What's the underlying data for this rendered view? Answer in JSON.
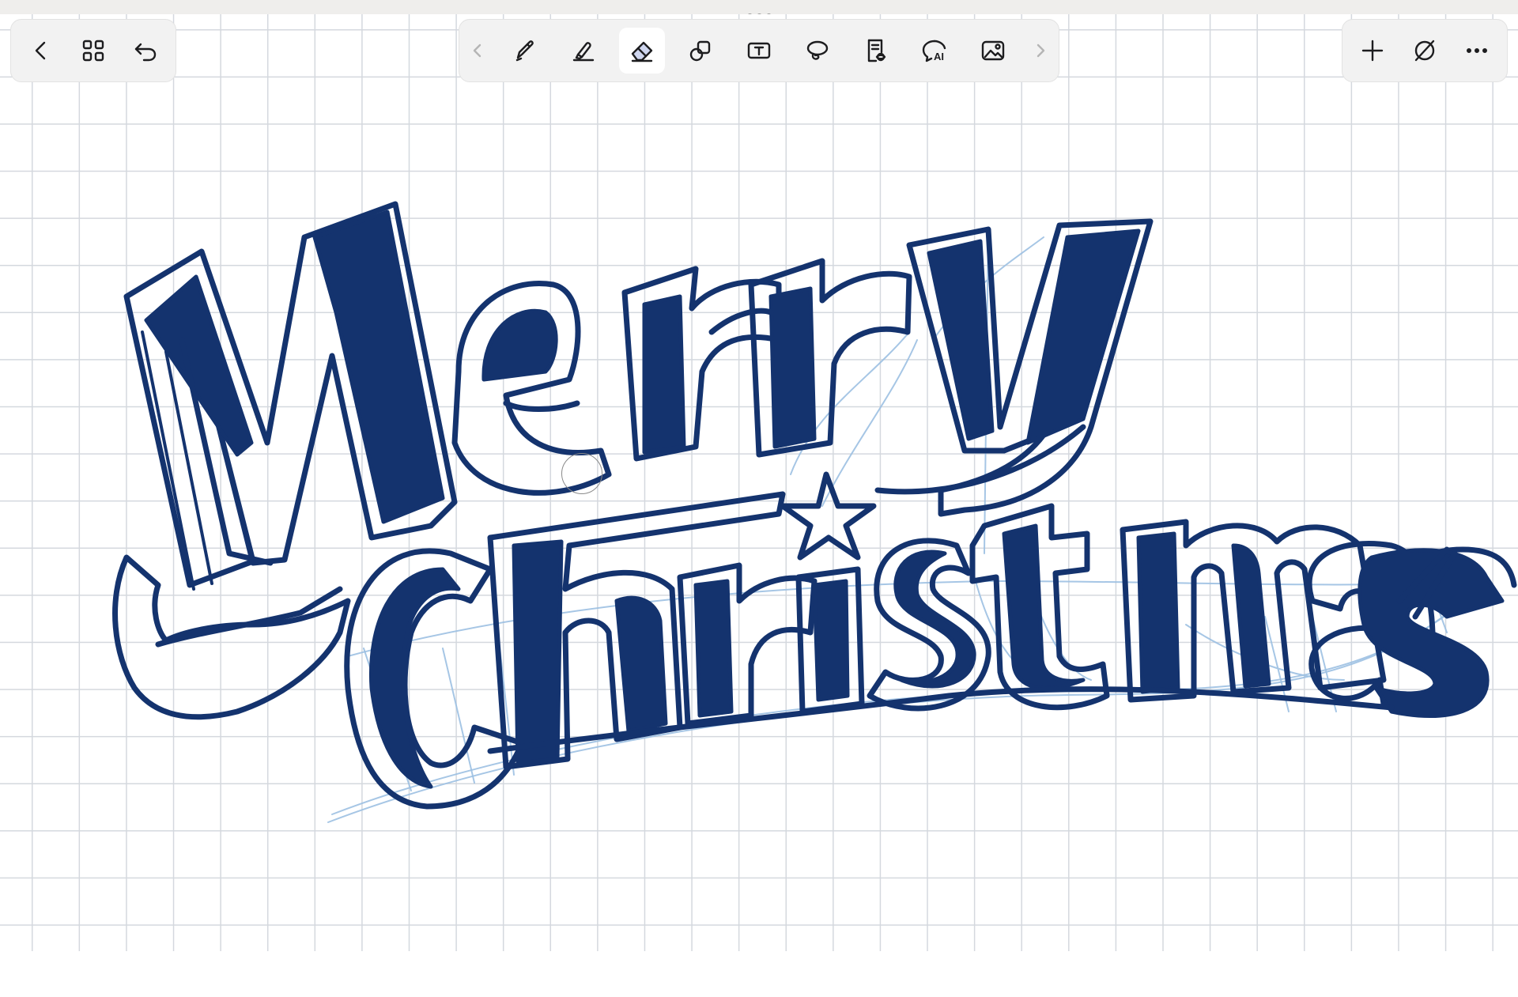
{
  "app": {
    "accent_color": "#1a3a78",
    "active_tool": "eraser"
  },
  "left_toolbar": {
    "items": [
      {
        "id": "back",
        "icon": "chevron-left-icon"
      },
      {
        "id": "pages",
        "icon": "grid-icon"
      },
      {
        "id": "undo",
        "icon": "undo-icon"
      }
    ]
  },
  "center_toolbar": {
    "items": [
      {
        "id": "scroll-left",
        "icon": "chevron-left-icon"
      },
      {
        "id": "pen",
        "icon": "pen-icon"
      },
      {
        "id": "highlighter",
        "icon": "highlighter-icon"
      },
      {
        "id": "eraser",
        "icon": "eraser-icon"
      },
      {
        "id": "shapes",
        "icon": "shapes-icon"
      },
      {
        "id": "text",
        "icon": "text-box-icon",
        "glyph": "T"
      },
      {
        "id": "lasso",
        "icon": "lasso-icon"
      },
      {
        "id": "read",
        "icon": "document-view-icon"
      },
      {
        "id": "ai",
        "icon": "ai-chat-icon",
        "glyph": "AI"
      },
      {
        "id": "image",
        "icon": "image-icon"
      },
      {
        "id": "scroll-right",
        "icon": "chevron-right-icon"
      }
    ]
  },
  "right_toolbar": {
    "items": [
      {
        "id": "add",
        "icon": "plus-icon"
      },
      {
        "id": "no-color",
        "icon": "slash-circle-icon"
      },
      {
        "id": "more",
        "icon": "more-icon"
      }
    ]
  },
  "canvas": {
    "background": "grid-paper",
    "ink_color": "#14336e",
    "sketch_color": "#9cc0e2",
    "lettering": [
      "Merry",
      "Christmas"
    ]
  }
}
